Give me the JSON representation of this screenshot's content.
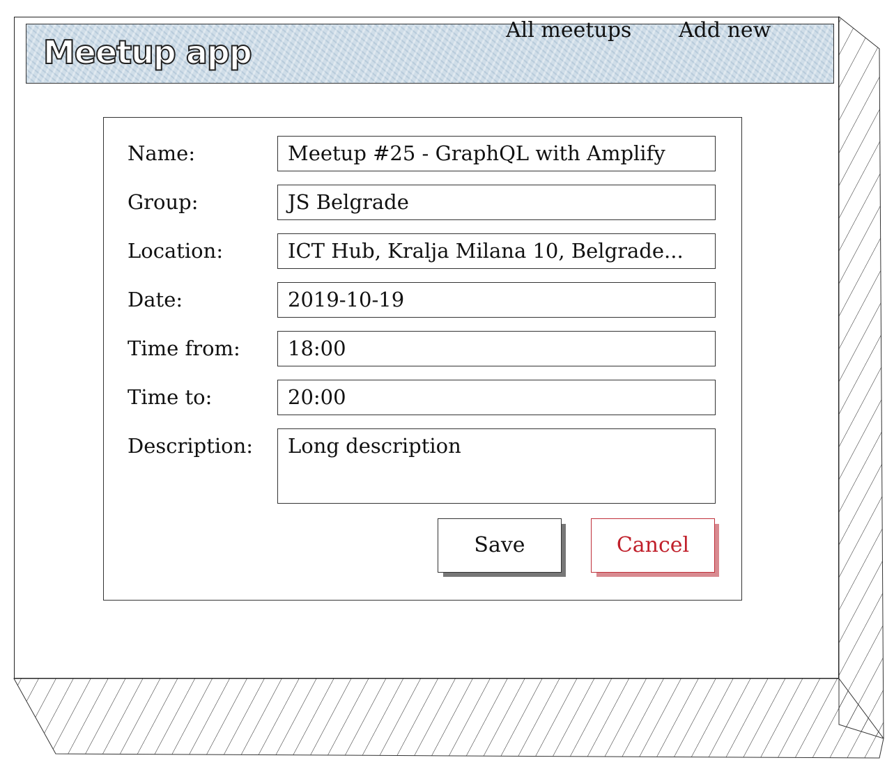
{
  "header": {
    "app_title": "Meetup app",
    "nav": {
      "all_meetups": "All meetups",
      "add_new": "Add new"
    }
  },
  "form": {
    "fields": [
      {
        "label": "Name:",
        "value": "Meetup #25 - GraphQL with Amplify"
      },
      {
        "label": "Group:",
        "value": "JS Belgrade"
      },
      {
        "label": "Location:",
        "value": "ICT Hub, Kralja Milana 10, Belgrade..."
      },
      {
        "label": "Date:",
        "value": "2019-10-19"
      },
      {
        "label": "Time from:",
        "value": "18:00"
      },
      {
        "label": "Time to:",
        "value": "20:00"
      },
      {
        "label": "Description:",
        "value": "Long description"
      }
    ],
    "buttons": {
      "save": "Save",
      "cancel": "Cancel"
    }
  },
  "colors": {
    "header_bg": "#cfdde8",
    "cancel_accent": "#c01f2a",
    "border": "#333333"
  }
}
